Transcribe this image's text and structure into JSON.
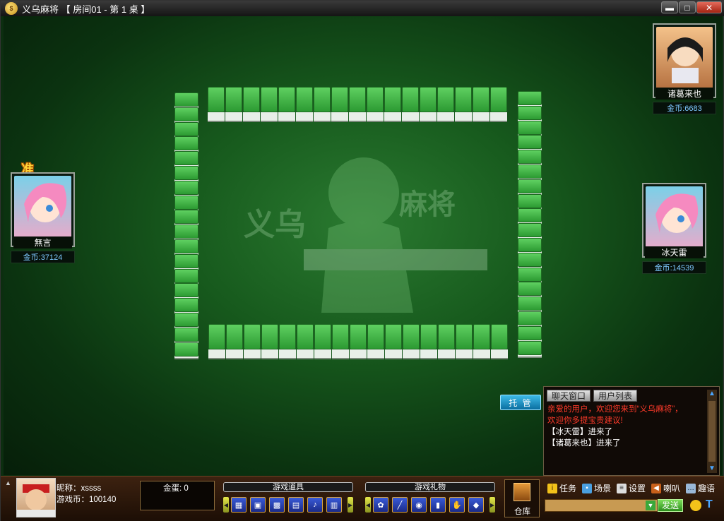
{
  "window": {
    "title": "义乌麻将 【 房间01 - 第 1 桌 】",
    "logo": "coins-logo-icon",
    "minimize_label": "▬",
    "maximize_label": "□",
    "close_label": "✕"
  },
  "table": {
    "watermark_text": "义乌 麻将"
  },
  "players": {
    "top_right": {
      "name": "诸葛来也",
      "coins": "金币:6683"
    },
    "left": {
      "name": "無言",
      "coins": "金币:37124",
      "status_badge": "准备"
    },
    "right": {
      "name": "冰天雷",
      "coins": "金币:14539"
    }
  },
  "trustee_button": "托 管",
  "chat": {
    "tabs": [
      "聊天窗口",
      "用户列表"
    ],
    "lines": [
      {
        "text": "亲爱的用户，欢迎您来到“义乌麻将”，",
        "color": "#ff3a2a"
      },
      {
        "text": "欢迎你多提宝贵建议!",
        "color": "#ff3a2a"
      },
      {
        "text": "【冰天雷】进来了",
        "color": "#ffffff"
      },
      {
        "text": "【诸葛来也】进来了",
        "color": "#ffffff"
      }
    ]
  },
  "self": {
    "nickname": "昵称：xssss",
    "game_coins": "游戏币：100140",
    "golden_eggs": "金蛋: 0"
  },
  "game_items": {
    "title": "游戏道具",
    "icons": [
      "card-swap-icon",
      "card-view-icon",
      "card-bomb-icon",
      "card-shield-icon",
      "speaker-icon",
      "card-reverse-icon"
    ]
  },
  "game_gifts": {
    "title": "游戏礼物",
    "icons": [
      "rose-icon",
      "stick-icon",
      "lips-icon",
      "beer-icon",
      "glove-icon",
      "fish-icon"
    ]
  },
  "warehouse_label": "仓库",
  "menu": {
    "tasks": "任务",
    "scene": "场景",
    "settings": "设置",
    "horn": "喇叭",
    "fun_words": "趣语"
  },
  "send_button": "发送",
  "colors": {
    "accent": "#2ea8e0",
    "felt": "#175a1d",
    "tile": "#3fb843"
  }
}
